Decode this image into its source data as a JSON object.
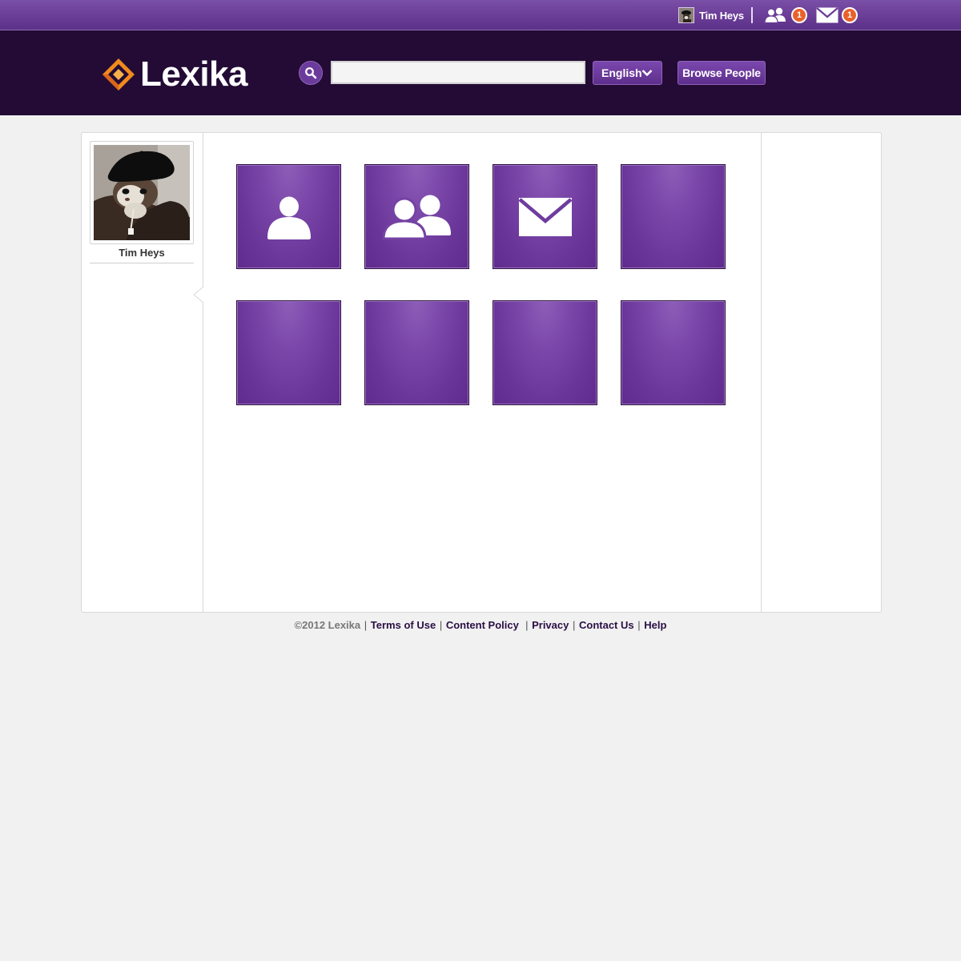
{
  "topbar": {
    "username": "Tim Heys",
    "friend_requests_count": "1",
    "messages_count": "1",
    "icons": {
      "avatar": "user-avatar-thumbnail",
      "friends": "friends-icon",
      "mail": "mail-icon"
    }
  },
  "header": {
    "logo_text": "Lexika",
    "search": {
      "placeholder": "",
      "value": "",
      "icon": "search-icon"
    },
    "language": {
      "selected": "English",
      "icon": "chevron-down-icon"
    },
    "browse_label": "Browse People"
  },
  "profile": {
    "name": "Tim Heys",
    "photo": "ferret-in-beret-photo"
  },
  "tiles": [
    {
      "icon": "user-icon"
    },
    {
      "icon": "friends-icon"
    },
    {
      "icon": "mail-icon"
    },
    {
      "icon": ""
    },
    {
      "icon": ""
    },
    {
      "icon": ""
    },
    {
      "icon": ""
    },
    {
      "icon": ""
    }
  ],
  "footer": {
    "copyright": "©2012 Lexika",
    "links": [
      "Terms of Use",
      "Content Policy",
      "Privacy",
      "Contact Us",
      "Help"
    ]
  },
  "colors": {
    "brand_purple": "#6a3598",
    "header_dark": "#230b35",
    "badge_orange": "#e8612a",
    "logo_orange": "#f08a1d"
  }
}
